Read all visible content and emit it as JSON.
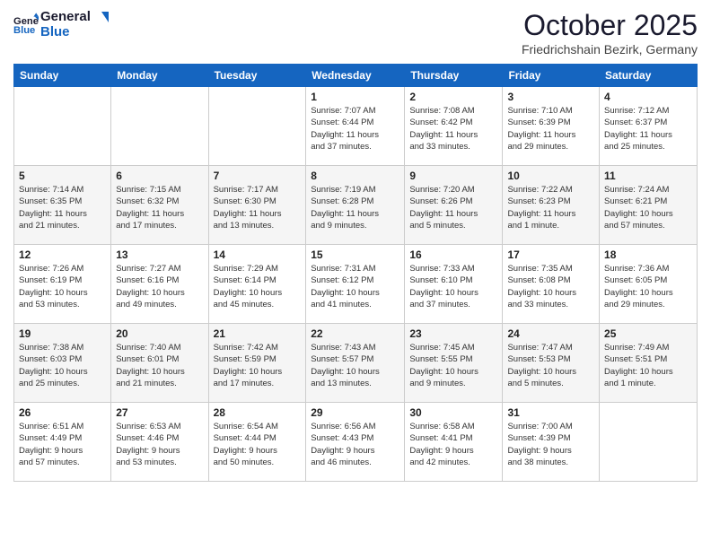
{
  "header": {
    "logo_line1": "General",
    "logo_line2": "Blue",
    "month_title": "October 2025",
    "subtitle": "Friedrichshain Bezirk, Germany"
  },
  "days_of_week": [
    "Sunday",
    "Monday",
    "Tuesday",
    "Wednesday",
    "Thursday",
    "Friday",
    "Saturday"
  ],
  "weeks": [
    [
      {
        "day": "",
        "info": ""
      },
      {
        "day": "",
        "info": ""
      },
      {
        "day": "",
        "info": ""
      },
      {
        "day": "1",
        "info": "Sunrise: 7:07 AM\nSunset: 6:44 PM\nDaylight: 11 hours\nand 37 minutes."
      },
      {
        "day": "2",
        "info": "Sunrise: 7:08 AM\nSunset: 6:42 PM\nDaylight: 11 hours\nand 33 minutes."
      },
      {
        "day": "3",
        "info": "Sunrise: 7:10 AM\nSunset: 6:39 PM\nDaylight: 11 hours\nand 29 minutes."
      },
      {
        "day": "4",
        "info": "Sunrise: 7:12 AM\nSunset: 6:37 PM\nDaylight: 11 hours\nand 25 minutes."
      }
    ],
    [
      {
        "day": "5",
        "info": "Sunrise: 7:14 AM\nSunset: 6:35 PM\nDaylight: 11 hours\nand 21 minutes."
      },
      {
        "day": "6",
        "info": "Sunrise: 7:15 AM\nSunset: 6:32 PM\nDaylight: 11 hours\nand 17 minutes."
      },
      {
        "day": "7",
        "info": "Sunrise: 7:17 AM\nSunset: 6:30 PM\nDaylight: 11 hours\nand 13 minutes."
      },
      {
        "day": "8",
        "info": "Sunrise: 7:19 AM\nSunset: 6:28 PM\nDaylight: 11 hours\nand 9 minutes."
      },
      {
        "day": "9",
        "info": "Sunrise: 7:20 AM\nSunset: 6:26 PM\nDaylight: 11 hours\nand 5 minutes."
      },
      {
        "day": "10",
        "info": "Sunrise: 7:22 AM\nSunset: 6:23 PM\nDaylight: 11 hours\nand 1 minute."
      },
      {
        "day": "11",
        "info": "Sunrise: 7:24 AM\nSunset: 6:21 PM\nDaylight: 10 hours\nand 57 minutes."
      }
    ],
    [
      {
        "day": "12",
        "info": "Sunrise: 7:26 AM\nSunset: 6:19 PM\nDaylight: 10 hours\nand 53 minutes."
      },
      {
        "day": "13",
        "info": "Sunrise: 7:27 AM\nSunset: 6:16 PM\nDaylight: 10 hours\nand 49 minutes."
      },
      {
        "day": "14",
        "info": "Sunrise: 7:29 AM\nSunset: 6:14 PM\nDaylight: 10 hours\nand 45 minutes."
      },
      {
        "day": "15",
        "info": "Sunrise: 7:31 AM\nSunset: 6:12 PM\nDaylight: 10 hours\nand 41 minutes."
      },
      {
        "day": "16",
        "info": "Sunrise: 7:33 AM\nSunset: 6:10 PM\nDaylight: 10 hours\nand 37 minutes."
      },
      {
        "day": "17",
        "info": "Sunrise: 7:35 AM\nSunset: 6:08 PM\nDaylight: 10 hours\nand 33 minutes."
      },
      {
        "day": "18",
        "info": "Sunrise: 7:36 AM\nSunset: 6:05 PM\nDaylight: 10 hours\nand 29 minutes."
      }
    ],
    [
      {
        "day": "19",
        "info": "Sunrise: 7:38 AM\nSunset: 6:03 PM\nDaylight: 10 hours\nand 25 minutes."
      },
      {
        "day": "20",
        "info": "Sunrise: 7:40 AM\nSunset: 6:01 PM\nDaylight: 10 hours\nand 21 minutes."
      },
      {
        "day": "21",
        "info": "Sunrise: 7:42 AM\nSunset: 5:59 PM\nDaylight: 10 hours\nand 17 minutes."
      },
      {
        "day": "22",
        "info": "Sunrise: 7:43 AM\nSunset: 5:57 PM\nDaylight: 10 hours\nand 13 minutes."
      },
      {
        "day": "23",
        "info": "Sunrise: 7:45 AM\nSunset: 5:55 PM\nDaylight: 10 hours\nand 9 minutes."
      },
      {
        "day": "24",
        "info": "Sunrise: 7:47 AM\nSunset: 5:53 PM\nDaylight: 10 hours\nand 5 minutes."
      },
      {
        "day": "25",
        "info": "Sunrise: 7:49 AM\nSunset: 5:51 PM\nDaylight: 10 hours\nand 1 minute."
      }
    ],
    [
      {
        "day": "26",
        "info": "Sunrise: 6:51 AM\nSunset: 4:49 PM\nDaylight: 9 hours\nand 57 minutes."
      },
      {
        "day": "27",
        "info": "Sunrise: 6:53 AM\nSunset: 4:46 PM\nDaylight: 9 hours\nand 53 minutes."
      },
      {
        "day": "28",
        "info": "Sunrise: 6:54 AM\nSunset: 4:44 PM\nDaylight: 9 hours\nand 50 minutes."
      },
      {
        "day": "29",
        "info": "Sunrise: 6:56 AM\nSunset: 4:43 PM\nDaylight: 9 hours\nand 46 minutes."
      },
      {
        "day": "30",
        "info": "Sunrise: 6:58 AM\nSunset: 4:41 PM\nDaylight: 9 hours\nand 42 minutes."
      },
      {
        "day": "31",
        "info": "Sunrise: 7:00 AM\nSunset: 4:39 PM\nDaylight: 9 hours\nand 38 minutes."
      },
      {
        "day": "",
        "info": ""
      }
    ]
  ]
}
